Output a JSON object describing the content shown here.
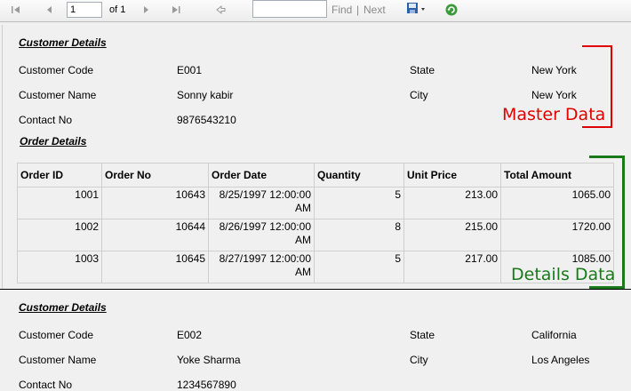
{
  "toolbar": {
    "page_value": "1",
    "of_label": "of 1",
    "find_label": "Find",
    "separator": "|",
    "next_label": "Next",
    "find_value": ""
  },
  "record1": {
    "heading": "Customer Details",
    "customer_code_label": "Customer Code",
    "customer_code": "E001",
    "customer_name_label": "Customer Name",
    "customer_name": "Sonny kabir",
    "contact_label": "Contact No",
    "contact": "9876543210",
    "state_label": "State",
    "state": "New York",
    "city_label": "City",
    "city": "New York"
  },
  "order_details": {
    "heading": "Order Details",
    "columns": [
      "Order ID",
      "Order No",
      "Order Date",
      "Quantity",
      "Unit Price",
      "Total Amount"
    ],
    "rows": [
      {
        "order_id": "1001",
        "order_no": "10643",
        "date_line1": "8/25/1997 12:00:00",
        "date_line2": "AM",
        "quantity": "5",
        "unit_price": "213.00",
        "total": "1065.00"
      },
      {
        "order_id": "1002",
        "order_no": "10644",
        "date_line1": "8/26/1997 12:00:00",
        "date_line2": "AM",
        "quantity": "8",
        "unit_price": "215.00",
        "total": "1720.00"
      },
      {
        "order_id": "1003",
        "order_no": "10645",
        "date_line1": "8/27/1997 12:00:00",
        "date_line2": "AM",
        "quantity": "5",
        "unit_price": "217.00",
        "total": "1085.00"
      }
    ]
  },
  "record2": {
    "heading": "Customer Details",
    "customer_code_label": "Customer Code",
    "customer_code": "E002",
    "customer_name_label": "Customer Name",
    "customer_name": "Yoke Sharma",
    "contact_label": "Contact No",
    "contact": "1234567890",
    "state_label": "State",
    "state": "California",
    "city_label": "City",
    "city": "Los Angeles"
  },
  "annotations": {
    "master": "Master Data",
    "details": "Details Data",
    "master_color": "#e00000",
    "details_color": "#1a7a1a"
  }
}
